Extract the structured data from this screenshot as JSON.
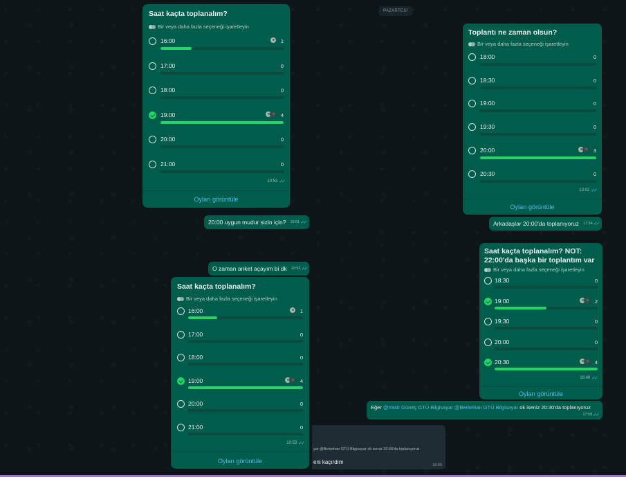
{
  "q1": {
    "poll": {
      "title": "Saat kaçta toplanalım?",
      "subtitle": "Bir veya daha fazla seçeneği işaretleyin",
      "options": [
        {
          "label": "16:00",
          "count": "1",
          "fill": 0.25,
          "checked": false
        },
        {
          "label": "17:00",
          "count": "0",
          "fill": 0,
          "checked": false
        },
        {
          "label": "18:00",
          "count": "0",
          "fill": 0,
          "checked": false
        },
        {
          "label": "19:00",
          "count": "4",
          "fill": 1.0,
          "checked": true
        },
        {
          "label": "20:00",
          "count": "0",
          "fill": 0,
          "checked": false
        },
        {
          "label": "21:00",
          "count": "0",
          "fill": 0,
          "checked": false
        }
      ],
      "time": "10:53",
      "view_votes": "Oyları görüntüle"
    }
  },
  "q2": {
    "day_pill": "PAZARTESİ",
    "poll": {
      "title": "Toplantı ne zaman olsun?",
      "subtitle": "Bir veya daha fazla seçeneği işaretleyin",
      "options": [
        {
          "label": "18:00",
          "count": "0",
          "fill": 0,
          "checked": false
        },
        {
          "label": "18:30",
          "count": "0",
          "fill": 0,
          "checked": false
        },
        {
          "label": "19:00",
          "count": "0",
          "fill": 0,
          "checked": false
        },
        {
          "label": "19:30",
          "count": "0",
          "fill": 0,
          "checked": false
        },
        {
          "label": "20:00",
          "count": "3",
          "fill": 1.0,
          "checked": false
        },
        {
          "label": "20:30",
          "count": "0",
          "fill": 0,
          "checked": false
        }
      ],
      "time": "13:02",
      "view_votes": "Oyları görüntüle"
    },
    "message": {
      "text": "Arkadaşlar 20:00'da toplanıyoruz",
      "time": "17:54"
    }
  },
  "q3": {
    "message1": {
      "text": "20:00 uygun mudur sizin için?",
      "time": "10:51"
    },
    "message2": {
      "text": "O zaman anket açayım bi dk",
      "time": "10:52"
    },
    "poll": {
      "title": "Saat kaçta toplanalım?",
      "subtitle": "Bir veya daha fazla seçeneği işaretleyin",
      "options": [
        {
          "label": "16:00",
          "count": "1",
          "fill": 0.25,
          "checked": false
        },
        {
          "label": "17:00",
          "count": "0",
          "fill": 0,
          "checked": false
        },
        {
          "label": "18:00",
          "count": "0",
          "fill": 0,
          "checked": false
        },
        {
          "label": "19:00",
          "count": "4",
          "fill": 1.0,
          "checked": true
        },
        {
          "label": "20:00",
          "count": "0",
          "fill": 0,
          "checked": false
        },
        {
          "label": "21:00",
          "count": "0",
          "fill": 0,
          "checked": false
        }
      ],
      "time": "10:53",
      "view_votes": "Oyları görüntüle"
    }
  },
  "q4": {
    "poll": {
      "title": "Saat kaçta toplanalım? NOT: 22:00'da başka bir toplantım var",
      "subtitle": "Bir veya daha fazla seçeneği işaretleyin",
      "options": [
        {
          "label": "18:30",
          "count": "0",
          "fill": 0,
          "checked": false
        },
        {
          "label": "19:00",
          "count": "2",
          "fill": 0.5,
          "checked": true
        },
        {
          "label": "19:30",
          "count": "0",
          "fill": 0,
          "checked": false
        },
        {
          "label": "20:00",
          "count": "0",
          "fill": 0,
          "checked": false
        },
        {
          "label": "20:30",
          "count": "4",
          "fill": 1.0,
          "checked": true
        }
      ],
      "time": "16:40",
      "view_votes": "Oyları görüntüle"
    },
    "message": {
      "prefix": "Eğer ",
      "mention1": "@Yasir Güneş GTÜ Bilgisayar",
      "mention2": "@Berkehan GTÜ Bilgisayar",
      "suffix": " ok iseniz 20:30'da toplanıyoruz",
      "time": "17:58"
    },
    "quoted": {
      "line1": "yar @Berkehan GTÜ Bilgisayar ok iseniz 20:30'da toplanıyoruz",
      "line2": "eni kaçırdım",
      "time": "18:05"
    }
  },
  "colors": {
    "bubble": "#005c4b",
    "accent": "#25d366",
    "link": "#53bdeb",
    "bg": "#0b141a"
  }
}
